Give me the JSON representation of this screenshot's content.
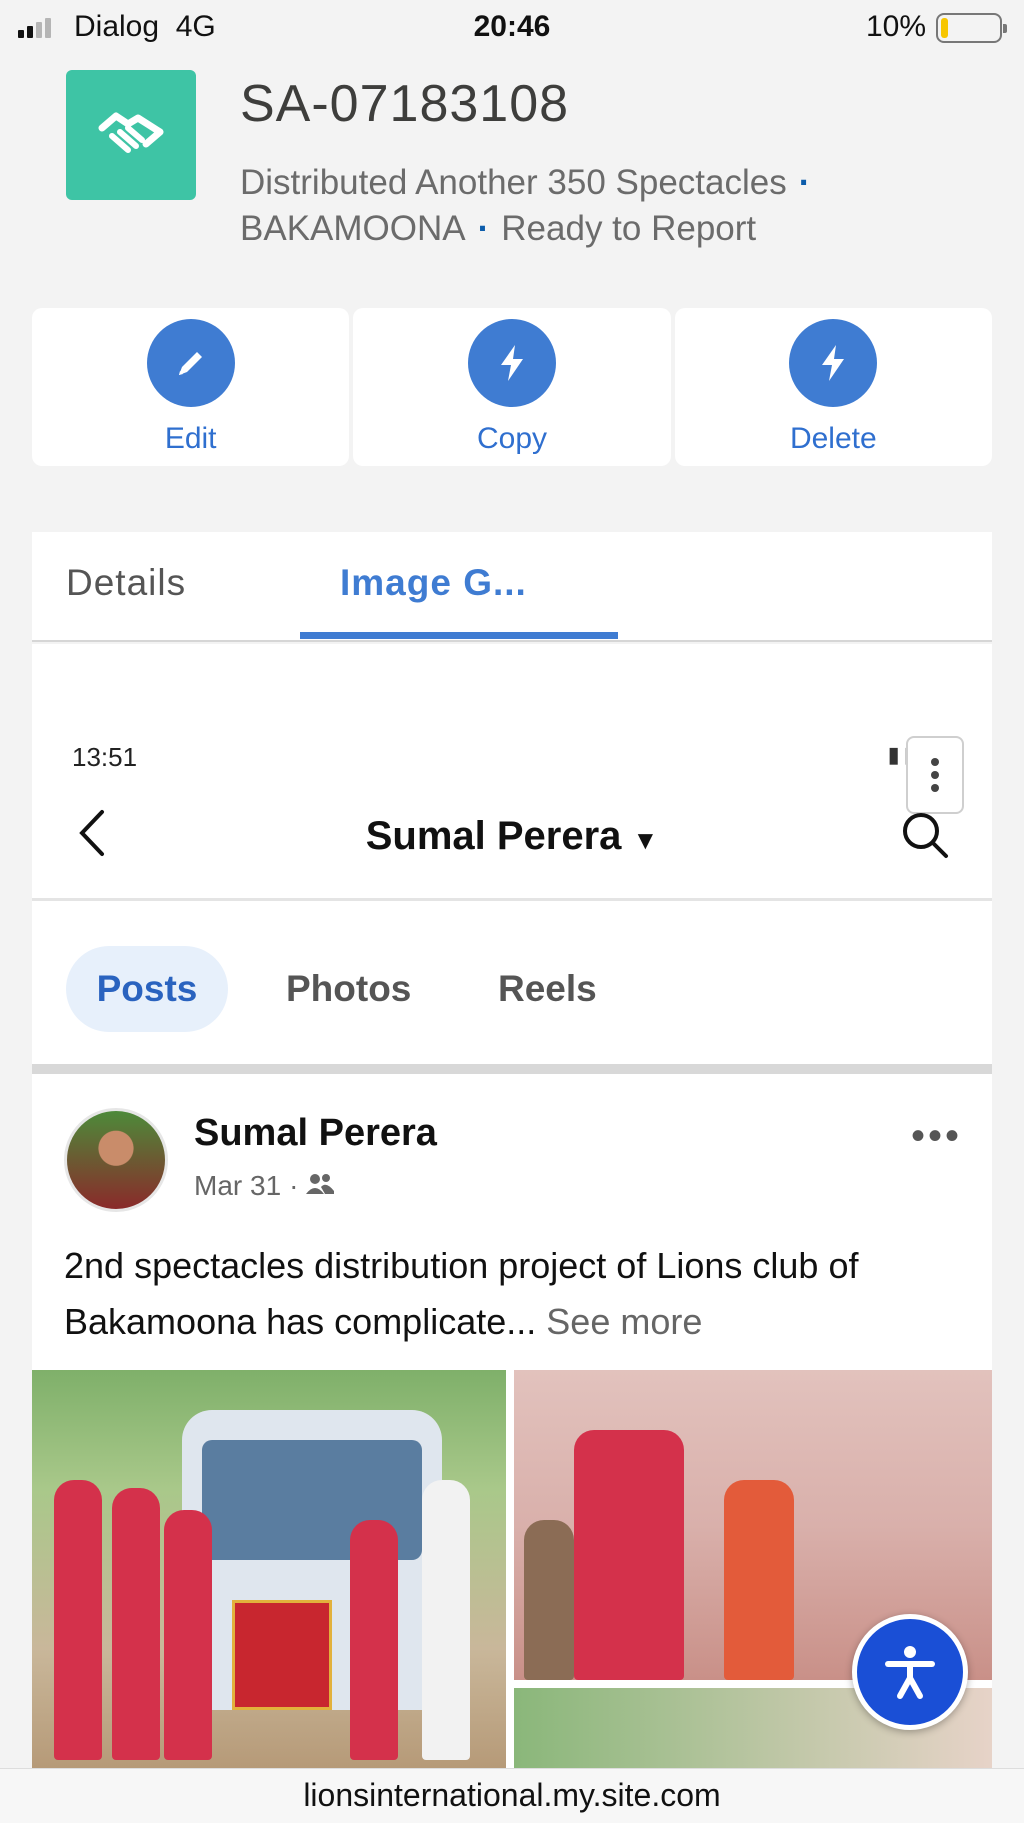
{
  "status_bar": {
    "carrier": "Dialog",
    "network": "4G",
    "time": "20:46",
    "battery": "10%"
  },
  "record": {
    "icon": "handshake-icon",
    "id": "SA-07183108",
    "subtitle_parts": [
      "Distributed Another 350 Spectacles",
      "BAKAMOONA",
      "Ready to Report"
    ],
    "accent_color": "#3ec4a5"
  },
  "actions": [
    {
      "label": "Edit",
      "icon": "pencil-icon"
    },
    {
      "label": "Copy",
      "icon": "lightning-icon"
    },
    {
      "label": "Delete",
      "icon": "lightning-icon"
    }
  ],
  "tabs": {
    "details": "Details",
    "images": "Image G...",
    "active": "images"
  },
  "embedded": {
    "status_time": "13:51",
    "profile_name": "Sumal Perera",
    "tabs": [
      "Posts",
      "Photos",
      "Reels"
    ],
    "active_tab": "Posts",
    "post": {
      "author": "Sumal Perera",
      "date": "Mar 31",
      "text": "2nd spectacles distribution project of Lions club of Bakamoona has complicate...",
      "see_more": "See more"
    }
  },
  "url": "lionsinternational.my.site.com"
}
